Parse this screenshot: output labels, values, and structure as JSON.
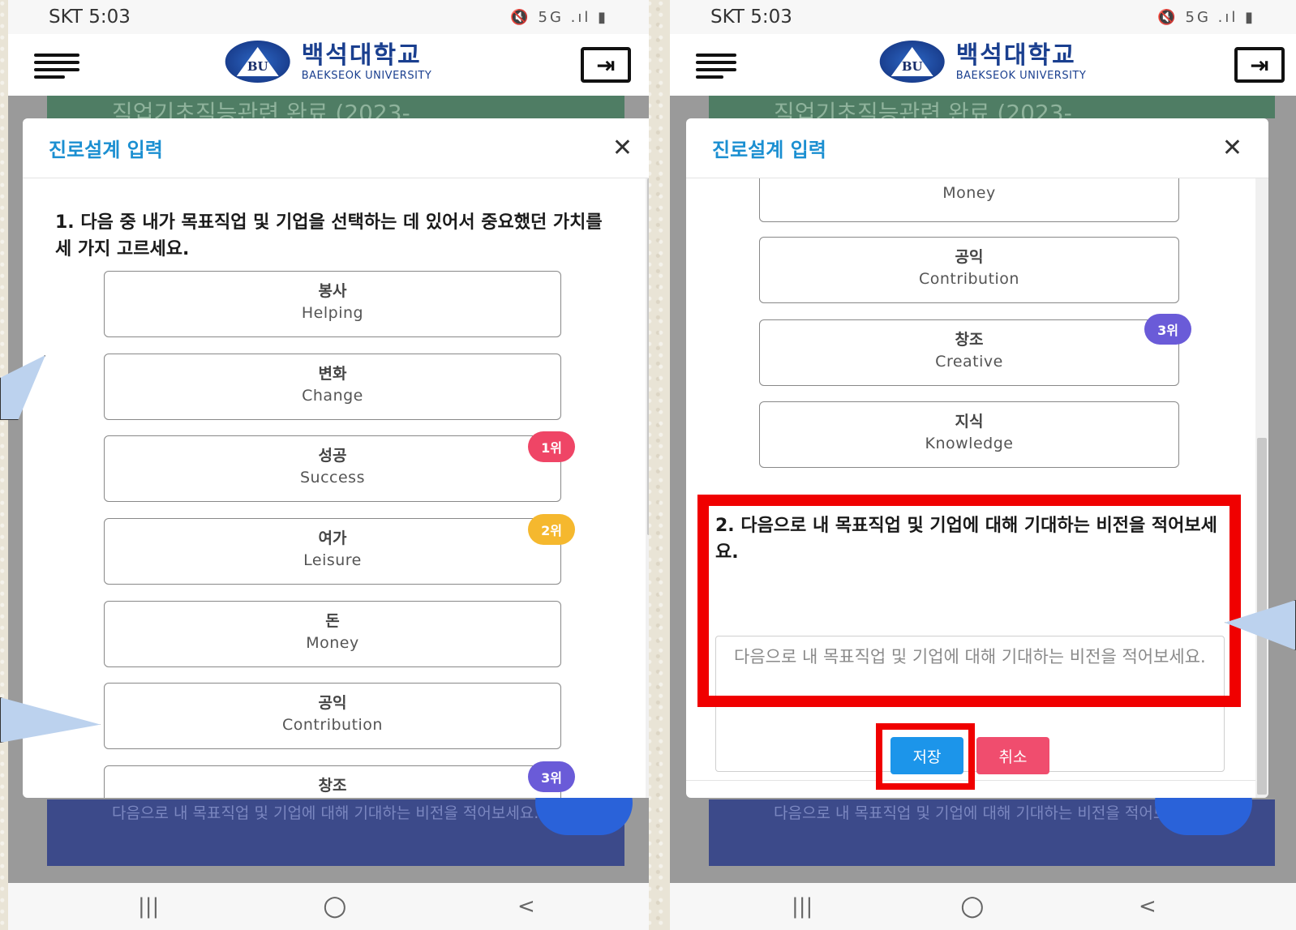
{
  "status_bar": {
    "carrier_time": "SKT 5:03",
    "icons": "🔇 5G .ıl ▮"
  },
  "header": {
    "logo_emblem": "BU",
    "logo_korean": "백석대학교",
    "logo_english": "BAEKSEOK UNIVERSITY"
  },
  "background_page": {
    "banner_text": "직업기초직능관련 완료 (2023-",
    "footer_text": "다음으로 내 목표직업 및 기업에 대해 기대하는 비전을 적어보세요."
  },
  "modal": {
    "title": "진로설계 입력",
    "close_symbol": "✕"
  },
  "question1": {
    "text": "1. 다음 중 내가 목표직업 및 기업을 선택하는 데 있어서 중요했던 가치를 세 가지 고르세요.",
    "options": [
      {
        "ko": "봉사",
        "en": "Helping",
        "rank": ""
      },
      {
        "ko": "변화",
        "en": "Change",
        "rank": ""
      },
      {
        "ko": "성공",
        "en": "Success",
        "rank": "1위"
      },
      {
        "ko": "여가",
        "en": "Leisure",
        "rank": "2위"
      },
      {
        "ko": "돈",
        "en": "Money",
        "rank": ""
      },
      {
        "ko": "공익",
        "en": "Contribution",
        "rank": ""
      },
      {
        "ko": "창조",
        "en": "Creative",
        "rank": "3위"
      },
      {
        "ko": "지식",
        "en": "Knowledge",
        "rank": ""
      }
    ]
  },
  "question2": {
    "text": "2. 다음으로 내 목표직업 및 기업에 대해 기대하는 비전을 적어보세요.",
    "placeholder": "다음으로 내 목표직업 및 기업에 대해 기대하는 비전을 적어보세요.",
    "value": ""
  },
  "buttons": {
    "save": "저장",
    "cancel": "취소"
  },
  "colors": {
    "title_blue": "#1b8fd1",
    "rank1": "#ef4566",
    "rank2": "#f5b82e",
    "rank3": "#6a5bd8",
    "save_btn": "#1c95ea",
    "cancel_btn": "#f04d6e",
    "highlight": "#f00000"
  },
  "nav": {
    "recents": "|||",
    "home": "○",
    "back": "<"
  }
}
